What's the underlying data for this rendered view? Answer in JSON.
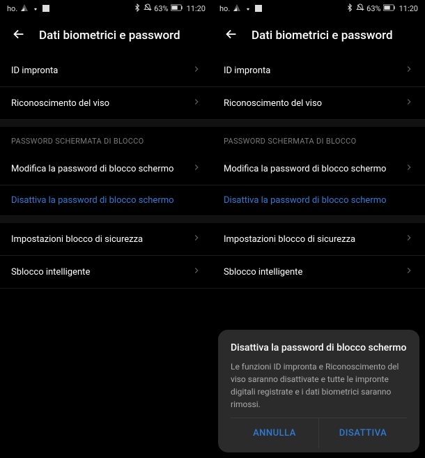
{
  "status": {
    "carrier": "ho.",
    "battery": "63%",
    "time": "11:20"
  },
  "header": {
    "title": "Dati biometrici e password"
  },
  "items": {
    "fingerprint": "ID impronta",
    "face": "Riconoscimento del viso"
  },
  "section": {
    "lockpw_header": "PASSWORD SCHERMATA DI BLOCCO",
    "change_pw": "Modifica la password di blocco schermo",
    "disable_pw": "Disattiva la password di blocco schermo",
    "security_settings": "Impostazioni blocco di sicurezza",
    "smart_unlock": "Sblocco intelligente"
  },
  "dialog": {
    "title": "Disattiva la password di blocco schermo",
    "body": "Le funzioni ID impronta e Riconoscimento del viso saranno disattivate e tutte le impronte digitali registrate e i dati biometrici saranno rimossi.",
    "cancel": "ANNULLA",
    "confirm": "DISATTIVA"
  }
}
